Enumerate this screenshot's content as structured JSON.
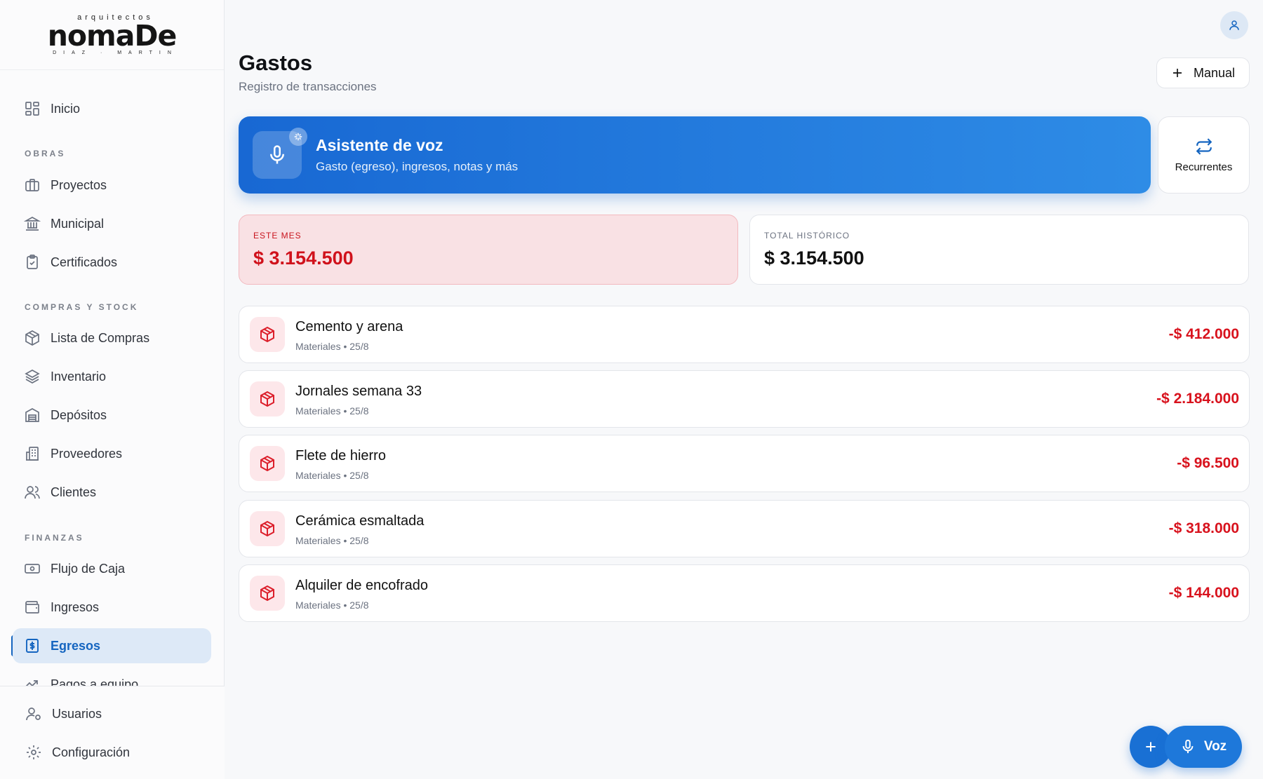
{
  "brand": {
    "top": "arquitectos",
    "main": "nomaDe",
    "bottom": "DIAZ · MARTIN"
  },
  "sidebar": {
    "inicio": "Inicio",
    "sections": {
      "obras": "OBRAS",
      "compras": "COMPRAS Y STOCK",
      "finanzas": "FINANZAS"
    },
    "items": {
      "proyectos": "Proyectos",
      "municipal": "Municipal",
      "certificados": "Certificados",
      "lista_compras": "Lista de Compras",
      "inventario": "Inventario",
      "depositos": "Depósitos",
      "proveedores": "Proveedores",
      "clientes": "Clientes",
      "flujo_caja": "Flujo de Caja",
      "ingresos": "Ingresos",
      "egresos": "Egresos",
      "pagos_equipo": "Pagos a equipo"
    },
    "bottom": {
      "usuarios": "Usuarios",
      "configuracion": "Configuración"
    }
  },
  "header": {
    "title": "Gastos",
    "subtitle": "Registro de transacciones",
    "manual_label": "Manual"
  },
  "voice_assistant": {
    "title": "Asistente de voz",
    "subtitle": "Gasto (egreso), ingresos, notas y más"
  },
  "recurrentes_label": "Recurrentes",
  "stats": {
    "month_label": "ESTE MES",
    "month_value": "$ 3.154.500",
    "total_label": "TOTAL HISTÓRICO",
    "total_value": "$ 3.154.500"
  },
  "transactions": [
    {
      "title": "Cemento y arena",
      "meta": "Materiales • 25/8",
      "amount": "-$ 412.000"
    },
    {
      "title": "Jornales semana 33",
      "meta": "Materiales • 25/8",
      "amount": "-$ 2.184.000"
    },
    {
      "title": "Flete de hierro",
      "meta": "Materiales • 25/8",
      "amount": "-$ 96.500"
    },
    {
      "title": "Cerámica esmaltada",
      "meta": "Materiales • 25/8",
      "amount": "-$ 318.000"
    },
    {
      "title": "Alquiler de encofrado",
      "meta": "Materiales • 25/8",
      "amount": "-$ 144.000"
    }
  ],
  "fab": {
    "voz_label": "Voz"
  },
  "colors": {
    "accent": "#1565c0",
    "expense": "#d8121d",
    "month_bg": "#f9e1e4"
  }
}
